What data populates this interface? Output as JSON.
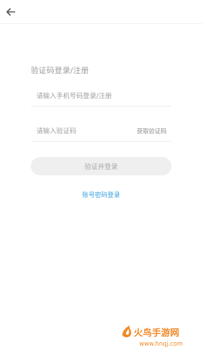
{
  "header": {
    "back_icon": "arrow-left-icon"
  },
  "form": {
    "title": "验证码登录/注册",
    "phone_placeholder": "请输入手机号码登录/注册",
    "code_placeholder": "请输入验证码",
    "get_code_label": "获取验证码",
    "submit_label": "验证并登录",
    "alt_login_link": "账号密码登录"
  },
  "watermark": {
    "brand_text": "火鸟手游网",
    "url_text": "www.hnqj.com"
  },
  "colors": {
    "link": "#3aa1df",
    "button_bg": "#efefef",
    "watermark_orange": "#f08a2a"
  }
}
